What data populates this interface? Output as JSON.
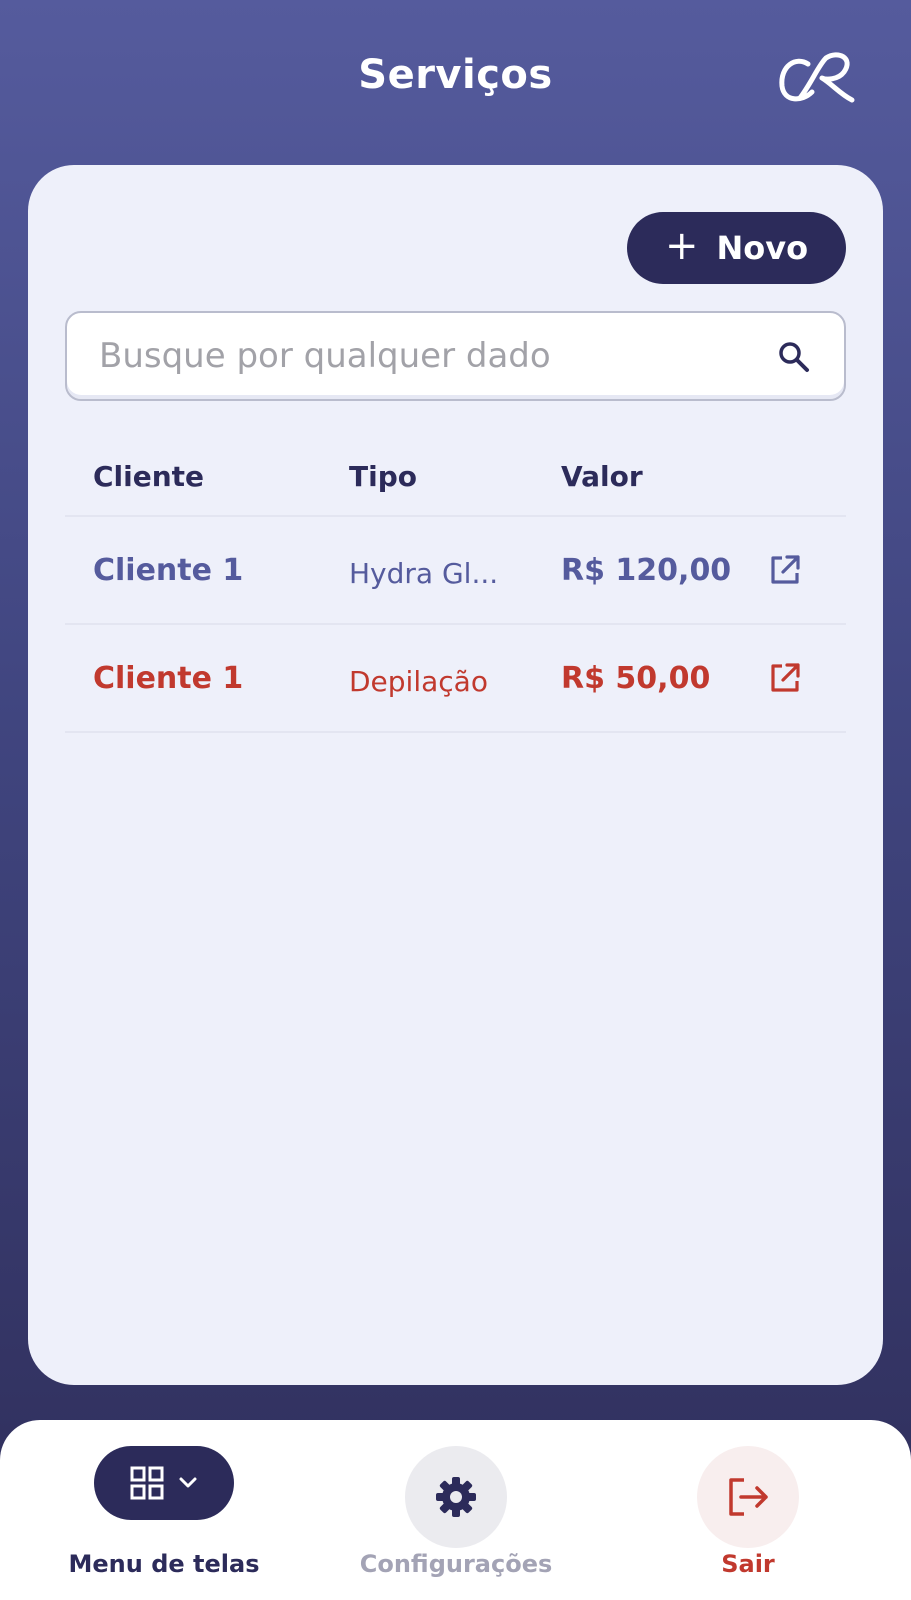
{
  "header": {
    "title": "Serviços",
    "logo": "CR-monogram-logo"
  },
  "card": {
    "new_button": {
      "icon": "plus-icon",
      "label": "Novo"
    },
    "search": {
      "placeholder": "Busque por qualquer dado",
      "icon": "search-icon"
    },
    "table": {
      "columns": [
        "Cliente",
        "Tipo",
        "Valor"
      ],
      "rows": [
        {
          "cliente": "Cliente 1",
          "tipo": "Hydra Gl...",
          "valor": "R$ 120,00",
          "color": "#555b9d",
          "action_icon": "open-external-icon"
        },
        {
          "cliente": "Cliente 1",
          "tipo": "Depilação",
          "valor": "R$ 50,00",
          "color": "#c1392e",
          "action_icon": "open-external-icon"
        }
      ]
    }
  },
  "bottom_nav": {
    "menu": {
      "label": "Menu de telas",
      "icon": "grid-icon",
      "chevron": "chevron-down-icon"
    },
    "settings": {
      "label": "Configurações",
      "icon": "gear-icon"
    },
    "exit": {
      "label": "Sair",
      "icon": "logout-icon"
    }
  },
  "colors": {
    "primary_dark": "#2c2b5a",
    "accent_blue": "#555b9d",
    "danger": "#c1392e",
    "card_bg": "#eef0fa"
  }
}
